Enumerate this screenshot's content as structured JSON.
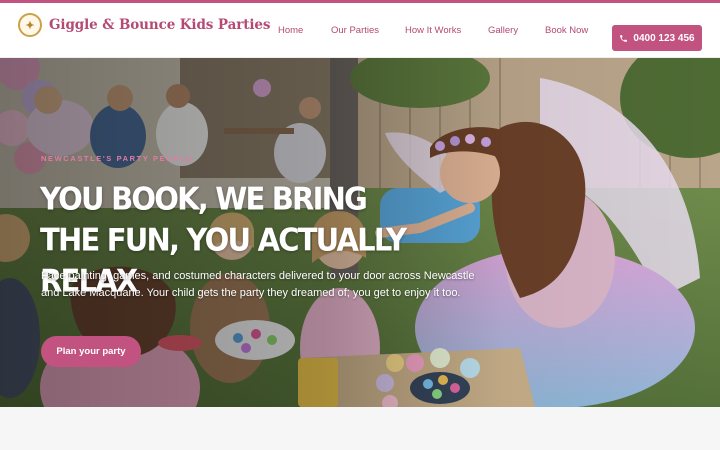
{
  "brand": {
    "name": "Giggle & Bounce Kids Parties",
    "logo_icon": "crest-icon"
  },
  "nav": {
    "items": [
      {
        "label": "Home"
      },
      {
        "label": "Our Parties"
      },
      {
        "label": "How It Works"
      },
      {
        "label": "Gallery"
      },
      {
        "label": "Book Now"
      }
    ]
  },
  "header": {
    "phone_icon": "phone-icon",
    "phone_label": "0400 123 456"
  },
  "hero": {
    "eyebrow": "Newcastle's party people",
    "title": "You book, we bring the fun, you actually relax",
    "description": "Face painting, games, and costumed characters delivered to your door across Newcastle and Lake Macquarie. Your child gets the party they dreamed of; you get to enjoy it too.",
    "cta_label": "Plan your party"
  },
  "colors": {
    "accent": "#c2527f",
    "accent_text": "#b44a74",
    "eyebrow": "#e07ba6",
    "logo_gold": "#c9a24a"
  }
}
